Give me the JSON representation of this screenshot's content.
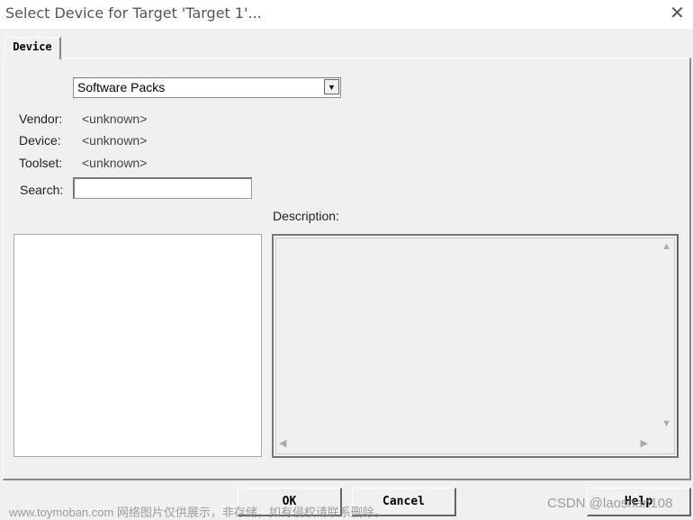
{
  "window": {
    "title": "Select Device for Target 'Target 1'...",
    "close_icon": "close-icon"
  },
  "tabs": [
    {
      "label": "Device",
      "active": true
    }
  ],
  "source": {
    "selected": "Software Packs"
  },
  "info": {
    "vendor_label": "Vendor:",
    "vendor_value": "<unknown>",
    "device_label": "Device:",
    "device_value": "<unknown>",
    "toolset_label": "Toolset:",
    "toolset_value": "<unknown>"
  },
  "search": {
    "label": "Search:",
    "value": ""
  },
  "description": {
    "label": "Description:",
    "text": ""
  },
  "buttons": {
    "ok": "OK",
    "cancel": "Cancel",
    "help": "Help"
  },
  "watermarks": {
    "left": "www.toymoban.com 网络图片仅供展示，非存储，如有侵权请联系删除。",
    "right": "CSDN @laoshan108"
  }
}
